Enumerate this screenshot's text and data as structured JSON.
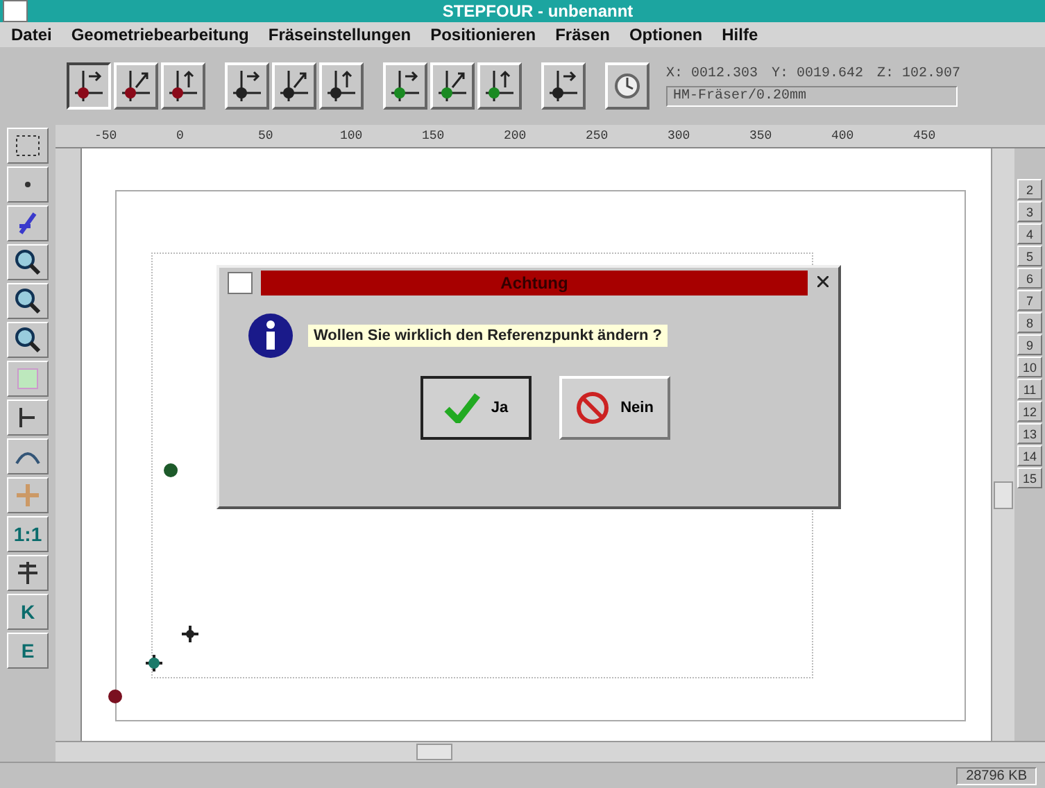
{
  "window": {
    "title": "STEPFOUR - unbenannt"
  },
  "menu": [
    "Datei",
    "Geometriebearbeitung",
    "Fräseinstellungen",
    "Positionieren",
    "Fräsen",
    "Optionen",
    "Hilfe"
  ],
  "tools": [
    {
      "selected": true
    },
    {
      "selected": false
    },
    {
      "selected": false
    },
    {
      "selected": false
    },
    {
      "selected": false
    },
    {
      "selected": false
    },
    {
      "selected": false
    },
    {
      "selected": false
    },
    {
      "selected": false
    },
    {
      "selected": false
    },
    {
      "selected": false
    }
  ],
  "position": {
    "x": "X: 0012.303",
    "y": "Y: 0019.642",
    "z": "Z: 102.907",
    "tool": "HM-Fräser/0.20mm"
  },
  "ruler": [
    "-50",
    "0",
    "50",
    "100",
    "150",
    "200",
    "250",
    "300",
    "350",
    "400",
    "450"
  ],
  "side_tools": [
    {
      "kind": "icon"
    },
    {
      "kind": "icon"
    },
    {
      "kind": "icon"
    },
    {
      "kind": "icon"
    },
    {
      "kind": "icon"
    },
    {
      "kind": "icon"
    },
    {
      "kind": "icon"
    },
    {
      "kind": "icon"
    },
    {
      "kind": "icon"
    },
    {
      "kind": "icon"
    },
    {
      "kind": "text",
      "label": "1:1"
    },
    {
      "kind": "icon"
    },
    {
      "kind": "text",
      "label": "K"
    },
    {
      "kind": "text",
      "label": "E"
    }
  ],
  "layers": [
    "2",
    "3",
    "4",
    "5",
    "6",
    "7",
    "8",
    "9",
    "10",
    "11",
    "12",
    "13",
    "14",
    "15"
  ],
  "dialog": {
    "title": "Achtung",
    "message": "Wollen Sie wirklich den Referenzpunkt ändern ?",
    "buttons": [
      {
        "label": "Ja",
        "kind": "yes",
        "selected": true
      },
      {
        "label": "Nein",
        "kind": "no",
        "selected": false
      }
    ]
  },
  "status": {
    "memory": "28796 KB"
  }
}
